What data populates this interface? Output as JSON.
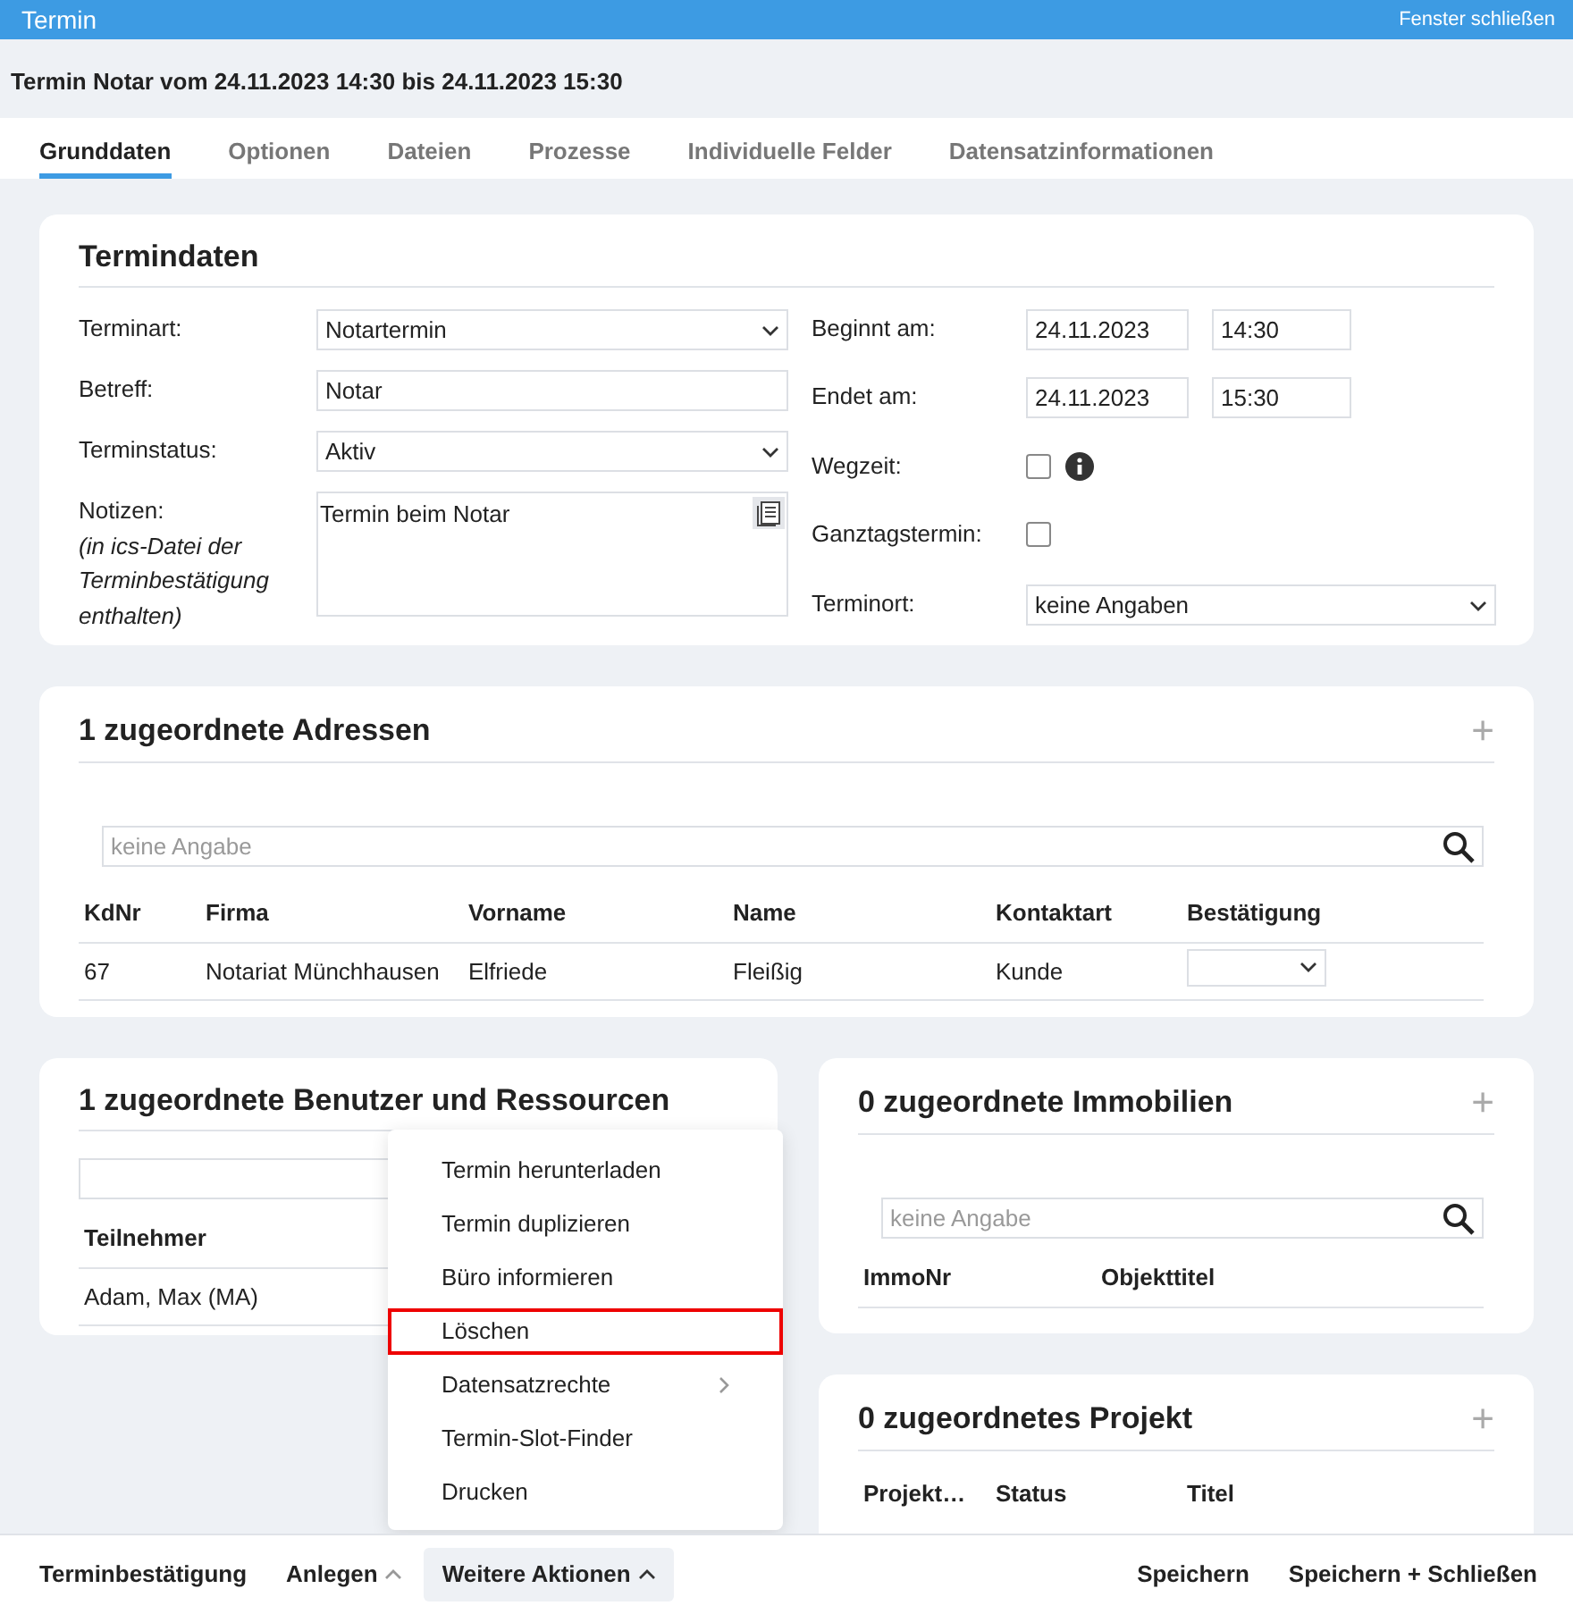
{
  "window": {
    "title": "Termin",
    "close_link": "Fenster schließen"
  },
  "heading": "Termin Notar vom 24.11.2023 14:30 bis 24.11.2023 15:30",
  "tabs": [
    {
      "label": "Grunddaten",
      "selected": true
    },
    {
      "label": "Optionen",
      "selected": false
    },
    {
      "label": "Dateien",
      "selected": false
    },
    {
      "label": "Prozesse",
      "selected": false
    },
    {
      "label": "Individuelle Felder",
      "selected": false
    },
    {
      "label": "Datensatzinformationen",
      "selected": false
    }
  ],
  "termindaten": {
    "title": "Termindaten",
    "left_fields": [
      {
        "kind": "select",
        "label": "Terminart:",
        "value": "Notartermin"
      },
      {
        "kind": "text",
        "label": "Betreff:",
        "value": "Notar"
      },
      {
        "kind": "select",
        "label": "Terminstatus:",
        "value": "Aktiv"
      },
      {
        "kind": "textarea",
        "label": "Notizen:",
        "note": "(in ics-Datei der Terminbestätigung enthalten)",
        "value": "Termin beim Notar"
      }
    ],
    "right_fields": [
      {
        "kind": "datetime",
        "label": "Beginnt am:",
        "date": "24.11.2023",
        "time": "14:30"
      },
      {
        "kind": "datetime",
        "label": "Endet am:",
        "date": "24.11.2023",
        "time": "15:30"
      },
      {
        "kind": "checkbox",
        "label": "Wegzeit:",
        "checked": false,
        "info": true
      },
      {
        "kind": "checkbox",
        "label": "Ganztagstermin:",
        "checked": false,
        "info": false
      },
      {
        "kind": "select",
        "label": "Terminort:",
        "value": "keine Angaben"
      }
    ]
  },
  "adressen": {
    "title": "1 zugeordnete Adressen",
    "add_button": "+",
    "search": {
      "placeholder": "keine Angabe"
    },
    "columns": [
      {
        "label": "KdNr"
      },
      {
        "label": "Firma"
      },
      {
        "label": "Vorname"
      },
      {
        "label": "Name"
      },
      {
        "label": "Kontaktart"
      },
      {
        "label": "Bestätigung",
        "kind": "select"
      }
    ],
    "rows": [
      {
        "cells": [
          "67",
          "Notariat Münchhausen",
          "Elfriede",
          "Fleißig",
          "Kunde"
        ]
      }
    ]
  },
  "benutzer": {
    "title": "1 zugeordnete Benutzer und Ressourcen",
    "columns": [
      "Teilnehmer"
    ],
    "rows": [
      [
        "Adam, Max (MA)"
      ]
    ]
  },
  "immobilien": {
    "title": "0 zugeordnete Immobilien",
    "add_button": "+",
    "search": {
      "placeholder": "keine Angabe"
    },
    "columns": [
      "ImmoNr",
      "Objekttitel"
    ]
  },
  "projekt": {
    "title": "0 zugeordnetes Projekt",
    "add_button": "+",
    "columns": [
      "Projekt…",
      "Status",
      "Titel"
    ]
  },
  "menu": {
    "items": [
      {
        "label": "Termin herunterladen",
        "highlighted": false,
        "submenu": false
      },
      {
        "label": "Termin duplizieren",
        "highlighted": false,
        "submenu": false
      },
      {
        "label": "Büro informieren",
        "highlighted": false,
        "submenu": false
      },
      {
        "label": "Löschen",
        "highlighted": true,
        "submenu": false
      },
      {
        "label": "Datensatzrechte",
        "highlighted": false,
        "submenu": true
      },
      {
        "label": "Termin-Slot-Finder",
        "highlighted": false,
        "submenu": false
      },
      {
        "label": "Drucken",
        "highlighted": false,
        "submenu": false
      }
    ]
  },
  "footer": {
    "left": [
      {
        "label": "Terminbestätigung",
        "caret": false,
        "expanded": false
      },
      {
        "label": "Anlegen",
        "caret": true,
        "expanded": false
      },
      {
        "label": "Weitere Aktionen",
        "caret": true,
        "expanded": true
      }
    ],
    "right": [
      {
        "label": "Speichern"
      },
      {
        "label": "Speichern + Schließen"
      }
    ]
  }
}
